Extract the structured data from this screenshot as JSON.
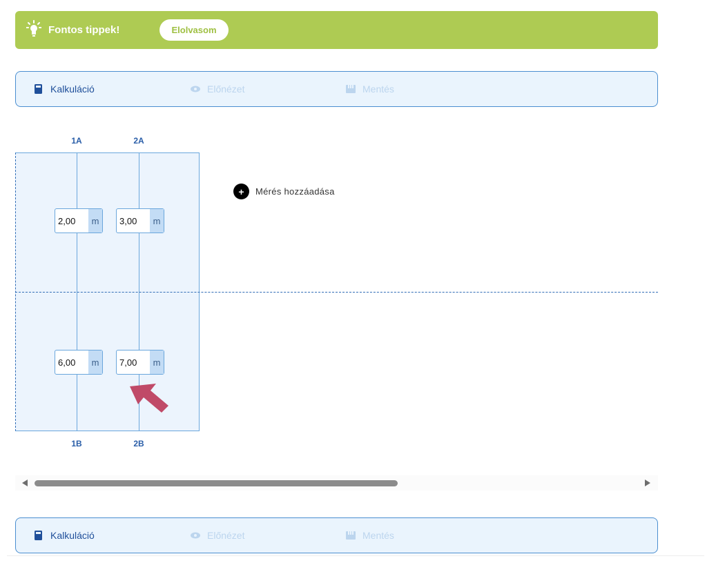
{
  "tips": {
    "icon": "lightbulb-icon",
    "title": "Fontos tippek!",
    "button_label": "Elolvasom",
    "color": "#aecb53"
  },
  "steps": [
    {
      "label": "Kalkuláció",
      "icon": "calculator-icon",
      "active": true
    },
    {
      "label": "Előnézet",
      "icon": "eye-icon",
      "active": false
    },
    {
      "label": "Mentés",
      "icon": "save-icon",
      "active": false
    }
  ],
  "columns": {
    "top": [
      "1A",
      "2A"
    ],
    "bottom": [
      "1B",
      "2B"
    ]
  },
  "measurements": [
    {
      "value": "2,00",
      "unit": "m"
    },
    {
      "value": "3,00",
      "unit": "m"
    },
    {
      "value": "6,00",
      "unit": "m"
    },
    {
      "value": "7,00",
      "unit": "m"
    }
  ],
  "add_measurement": {
    "label": "Mérés hozzáadása",
    "icon": "plus-circle-icon"
  },
  "colors": {
    "accent": "#1f4f9a",
    "border": "#4a8ed0",
    "panel": "#eaf4fd",
    "arrow": "#c04a68"
  }
}
